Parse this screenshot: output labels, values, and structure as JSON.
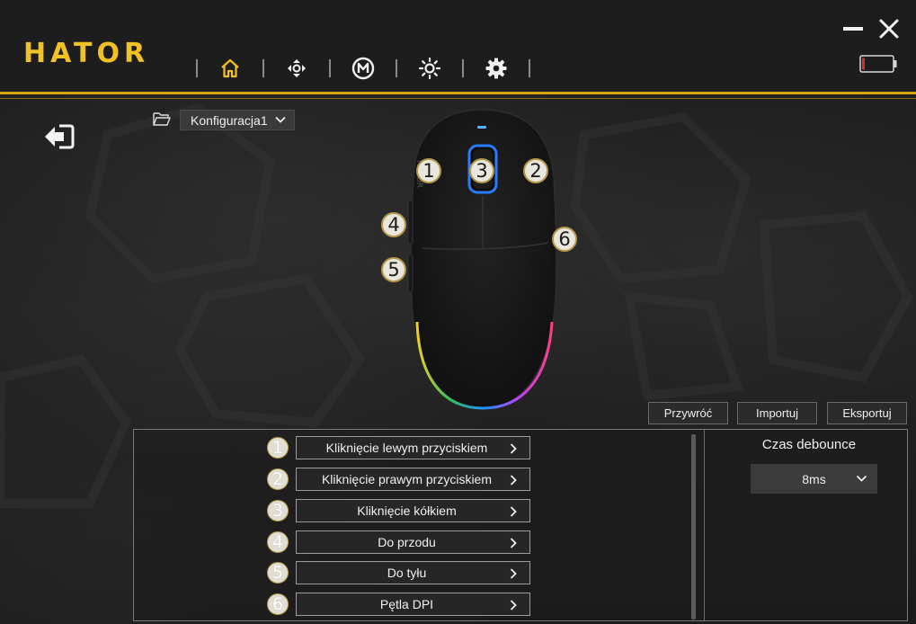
{
  "app": {
    "logo": "HATOR"
  },
  "nav": [
    {
      "id": "home",
      "icon": "home-icon",
      "active": true
    },
    {
      "id": "buttons",
      "icon": "dpad-icon",
      "active": false
    },
    {
      "id": "macro",
      "icon": "macro-m-icon",
      "active": false
    },
    {
      "id": "lighting",
      "icon": "sun-icon",
      "active": false
    },
    {
      "id": "settings",
      "icon": "gear-icon",
      "active": false
    }
  ],
  "window": {
    "minimize_icon": "minimize-icon",
    "close_icon": "close-icon",
    "battery_icon": "battery-low-icon"
  },
  "colors": {
    "accent": "#d6a614",
    "logo": "#f2c224",
    "battery_low": "#d23030"
  },
  "config": {
    "selected": "Konfiguracja1"
  },
  "mouse_markers": [
    "1",
    "3",
    "2",
    "4",
    "6",
    "5"
  ],
  "actions": {
    "reset": "Przywróć",
    "import": "Importuj",
    "export": "Eksportuj"
  },
  "bindings": [
    {
      "num": "1",
      "label": "Kliknięcie lewym przyciskiem"
    },
    {
      "num": "2",
      "label": "Kliknięcie prawym przyciskiem"
    },
    {
      "num": "3",
      "label": "Kliknięcie kółkiem"
    },
    {
      "num": "4",
      "label": "Do przodu"
    },
    {
      "num": "5",
      "label": "Do tyłu"
    },
    {
      "num": "6",
      "label": "Pętla DPI"
    }
  ],
  "debounce": {
    "label": "Czas debounce",
    "value": "8ms"
  }
}
